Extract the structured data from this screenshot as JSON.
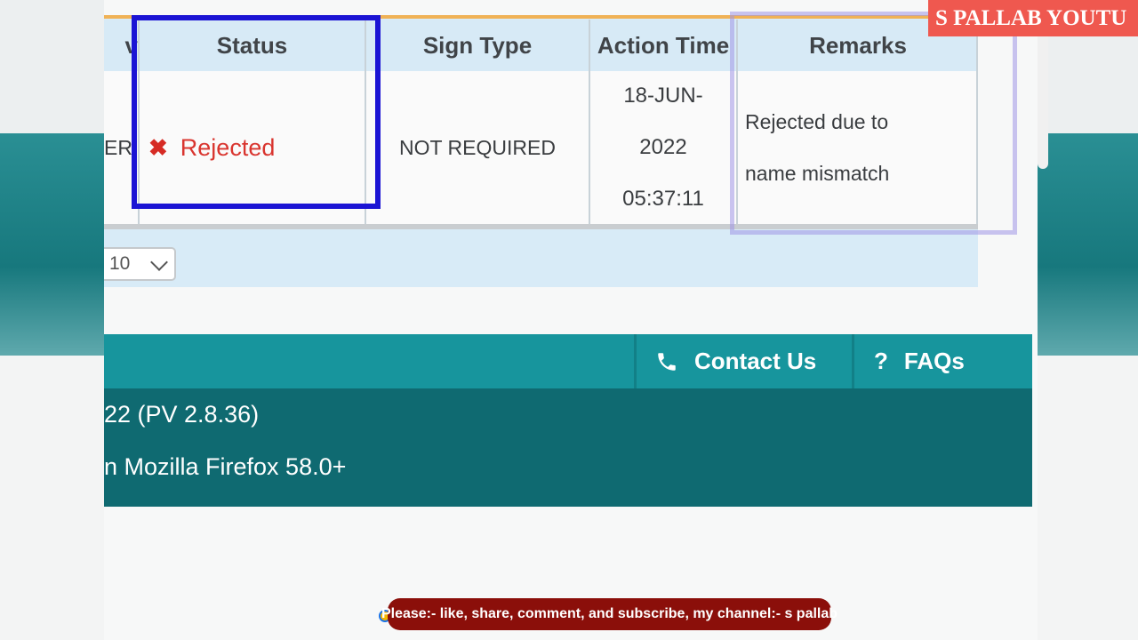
{
  "table": {
    "headers": {
      "prev_col_fragment": "v",
      "status": "Status",
      "sign_type": "Sign Type",
      "action_time": "Action Time",
      "remarks": "Remarks"
    },
    "row": {
      "prev_col_fragment": "ER",
      "status": "Rejected",
      "sign_type": "NOT REQUIRED",
      "action_time_line1": "18-JUN-",
      "action_time_line2": "2022",
      "action_time_line3": "05:37:11",
      "remarks_line1": "Rejected due to",
      "remarks_line2": "name mismatch"
    },
    "page_size_value": "10"
  },
  "footer": {
    "contact_label": "Contact Us",
    "faqs_label": "FAQs",
    "faq_glyph": "?",
    "version_text": "22 (PV 2.8.36)",
    "browser_text": "n Mozilla Firefox 58.0+"
  },
  "overlay": {
    "watermark": "S PALLAB YOUTU",
    "banner": "Please:- like, share, comment, and subscribe, my channel:- s pallab"
  },
  "icons": {
    "status_icon": "x-icon",
    "contact_icon": "phone-icon",
    "faq_icon": "question-icon",
    "select_icon": "chevron-down-icon"
  },
  "colors": {
    "rejected": "#d9352f",
    "highlight_box": "#1b14d4",
    "footer_bar": "#17959d",
    "footer_bg": "#0f6a71",
    "watermark_bg": "#ef584f",
    "banner_bg": "#8b0f0a"
  }
}
